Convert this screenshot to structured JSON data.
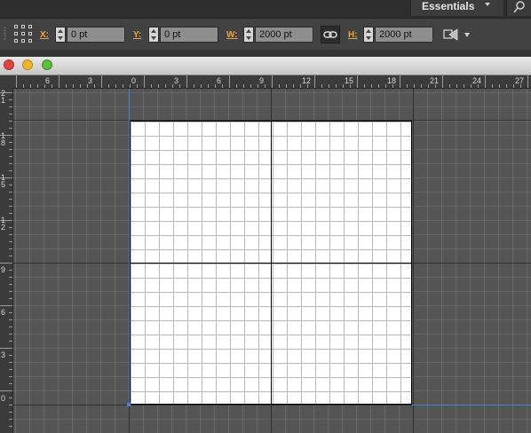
{
  "app_bar": {
    "workspace_label": "Essentials"
  },
  "control_bar": {
    "x_label": "X:",
    "x_value": "0 pt",
    "y_label": "Y:",
    "y_value": "0 pt",
    "w_label": "W:",
    "w_value": "2000 pt",
    "h_label": "H:",
    "h_value": "2000 pt",
    "icons": {
      "reference_point": "reference-point-grid-icon",
      "link": "link-chain-icon",
      "transform": "transform-options-icon"
    }
  },
  "ruler_h": [
    "6",
    "3",
    "0",
    "3",
    "6",
    "9",
    "12",
    "15",
    "18",
    "21",
    "24",
    "27"
  ],
  "ruler_v": [
    "2\n1",
    "1\n8",
    "1\n5",
    "1\n2",
    "9",
    "6",
    "3",
    "0"
  ],
  "colors": {
    "label_orange": "#e8a53c",
    "guide_blue": "#4a7fd6",
    "close_red": "#e0443e",
    "minimize_yellow": "#f0b429",
    "zoom_green": "#5bc236"
  }
}
